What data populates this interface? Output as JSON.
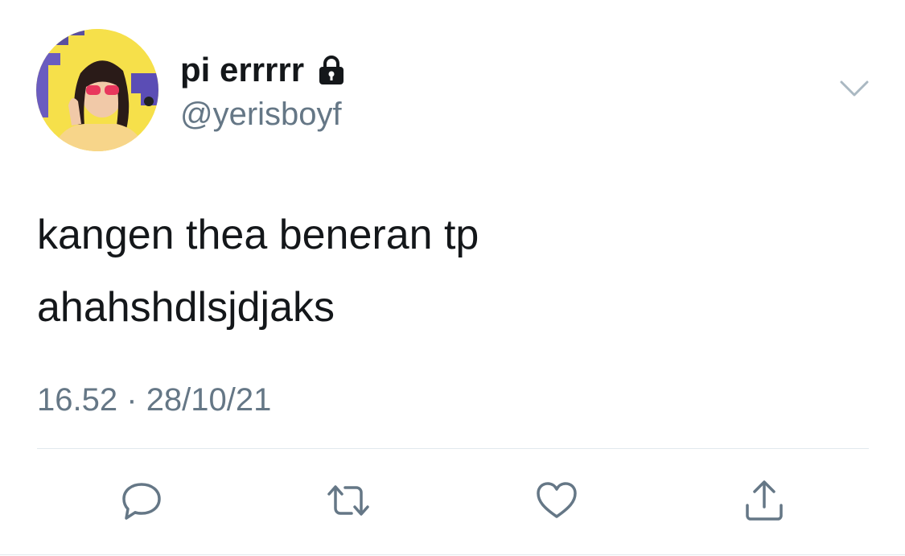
{
  "user": {
    "display_name": "pi errrrr",
    "handle": "@yerisboyf",
    "protected_icon": "lock-icon",
    "avatar_bg": "#f6e04a"
  },
  "tweet": {
    "text_lines": [
      "kangen thea beneran tp",
      "ahahshdlsjdjaks"
    ],
    "time": "16.52",
    "separator": "·",
    "date": "28/10/21"
  },
  "actions": [
    {
      "name": "reply",
      "icon": "comment-icon"
    },
    {
      "name": "retweet",
      "icon": "retweet-icon"
    },
    {
      "name": "like",
      "icon": "heart-icon"
    },
    {
      "name": "share",
      "icon": "share-icon"
    }
  ],
  "colors": {
    "text": "#14171a",
    "secondary": "#657786",
    "divider": "#e1e8ed",
    "caret": "#aab8c2"
  }
}
